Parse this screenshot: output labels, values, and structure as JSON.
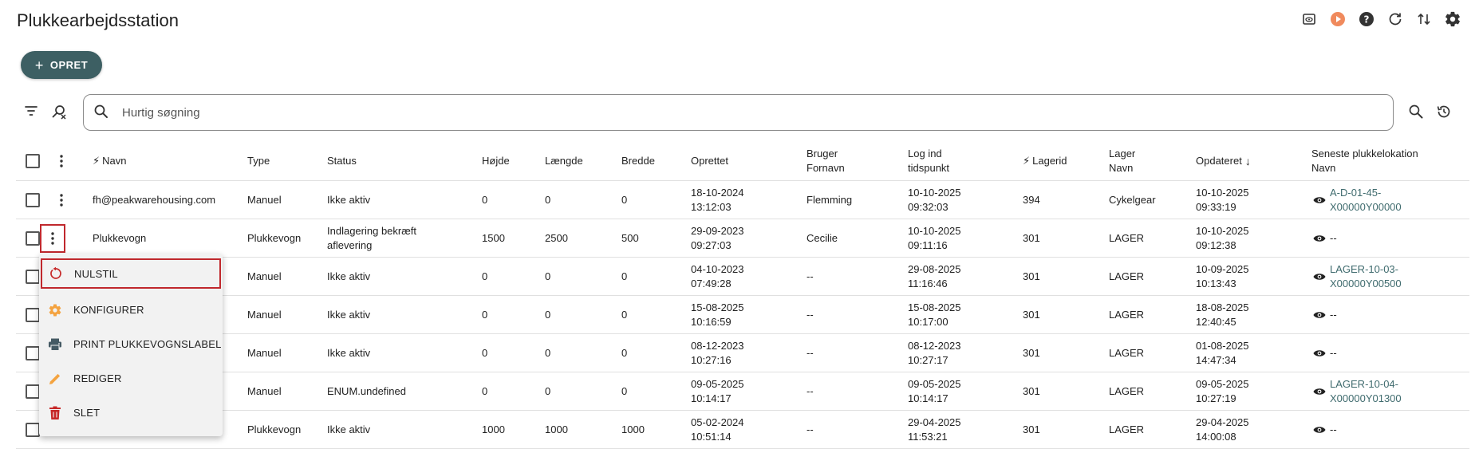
{
  "page": {
    "title": "Plukkearbejdsstation"
  },
  "toolbar": {
    "create_label": "OPRET"
  },
  "search": {
    "placeholder": "Hurtig søgning"
  },
  "columns": {
    "navn": "Navn",
    "type": "Type",
    "status": "Status",
    "hojde": "Højde",
    "laengde": "Længde",
    "bredde": "Bredde",
    "oprettet": "Oprettet",
    "bruger_fornavn": "Bruger Fornavn",
    "log_ind": "Log ind tidspunkt",
    "lagerid": "Lagerid",
    "lager_navn": "Lager Navn",
    "opdateret": "Opdateret",
    "seneste": "Seneste plukkelokation Navn"
  },
  "rows": [
    {
      "navn": "fh@peakwarehousing.com",
      "type": "Manuel",
      "status": "Ikke aktiv",
      "hojde": "0",
      "laengde": "0",
      "bredde": "0",
      "oprettet_d": "18-10-2024",
      "oprettet_t": "13:12:03",
      "bruger": "Flemming",
      "log_d": "10-10-2025",
      "log_t": "09:32:03",
      "lagerid": "394",
      "lager": "Cykelgear",
      "opd_d": "10-10-2025",
      "opd_t": "09:33:19",
      "loc1": "A-D-01-45-",
      "loc2": "X00000Y00000"
    },
    {
      "navn": "Plukkevogn",
      "type": "Plukkevogn",
      "status": "Indlagering bekræft aflevering",
      "hojde": "1500",
      "laengde": "2500",
      "bredde": "500",
      "oprettet_d": "29-09-2023",
      "oprettet_t": "09:27:03",
      "bruger": "Cecilie",
      "log_d": "10-10-2025",
      "log_t": "09:11:16",
      "lagerid": "301",
      "lager": "LAGER",
      "opd_d": "10-10-2025",
      "opd_t": "09:12:38",
      "loc1": "--",
      "loc2": ""
    },
    {
      "navn": "",
      "type": "Manuel",
      "status": "Ikke aktiv",
      "hojde": "0",
      "laengde": "0",
      "bredde": "0",
      "oprettet_d": "04-10-2023",
      "oprettet_t": "07:49:28",
      "bruger": "--",
      "log_d": "29-08-2025",
      "log_t": "11:16:46",
      "lagerid": "301",
      "lager": "LAGER",
      "opd_d": "10-09-2025",
      "opd_t": "10:13:43",
      "loc1": "LAGER-10-03-",
      "loc2": "X00000Y00500"
    },
    {
      "navn": "",
      "type": "Manuel",
      "status": "Ikke aktiv",
      "hojde": "0",
      "laengde": "0",
      "bredde": "0",
      "oprettet_d": "15-08-2025",
      "oprettet_t": "10:16:59",
      "bruger": "--",
      "log_d": "15-08-2025",
      "log_t": "10:17:00",
      "lagerid": "301",
      "lager": "LAGER",
      "opd_d": "18-08-2025",
      "opd_t": "12:40:45",
      "loc1": "--",
      "loc2": ""
    },
    {
      "navn": "",
      "type": "Manuel",
      "status": "Ikke aktiv",
      "hojde": "0",
      "laengde": "0",
      "bredde": "0",
      "oprettet_d": "08-12-2023",
      "oprettet_t": "10:27:16",
      "bruger": "--",
      "log_d": "08-12-2023",
      "log_t": "10:27:17",
      "lagerid": "301",
      "lager": "LAGER",
      "opd_d": "01-08-2025",
      "opd_t": "14:47:34",
      "loc1": "--",
      "loc2": ""
    },
    {
      "navn": "",
      "type": "Manuel",
      "status": "ENUM.undefined",
      "hojde": "0",
      "laengde": "0",
      "bredde": "0",
      "oprettet_d": "09-05-2025",
      "oprettet_t": "10:14:17",
      "bruger": "--",
      "log_d": "09-05-2025",
      "log_t": "10:14:17",
      "lagerid": "301",
      "lager": "LAGER",
      "opd_d": "09-05-2025",
      "opd_t": "10:27:19",
      "loc1": "LAGER-10-04-",
      "loc2": "X00000Y01300"
    },
    {
      "navn": "",
      "type": "Plukkevogn",
      "status": "Ikke aktiv",
      "hojde": "1000",
      "laengde": "1000",
      "bredde": "1000",
      "oprettet_d": "05-02-2024",
      "oprettet_t": "10:51:14",
      "bruger": "--",
      "log_d": "29-04-2025",
      "log_t": "11:53:21",
      "lagerid": "301",
      "lager": "LAGER",
      "opd_d": "29-04-2025",
      "opd_t": "14:00:08",
      "loc1": "--",
      "loc2": ""
    }
  ],
  "context_menu": {
    "items": [
      {
        "label": "NULSTIL",
        "icon": "reset-icon"
      },
      {
        "label": "KONFIGURER",
        "icon": "gear-icon"
      },
      {
        "label": "PRINT PLUKKEVOGNSLABEL",
        "icon": "printer-icon"
      },
      {
        "label": "REDIGER",
        "icon": "pencil-icon"
      },
      {
        "label": "SLET",
        "icon": "trash-icon"
      }
    ]
  },
  "colors": {
    "accent": "#3d5f63",
    "link": "#3f6b6e",
    "highlight": "#c0282d",
    "play": "#f08a5d",
    "warn_icon": "#f4a340",
    "delete_icon": "#c62828"
  }
}
